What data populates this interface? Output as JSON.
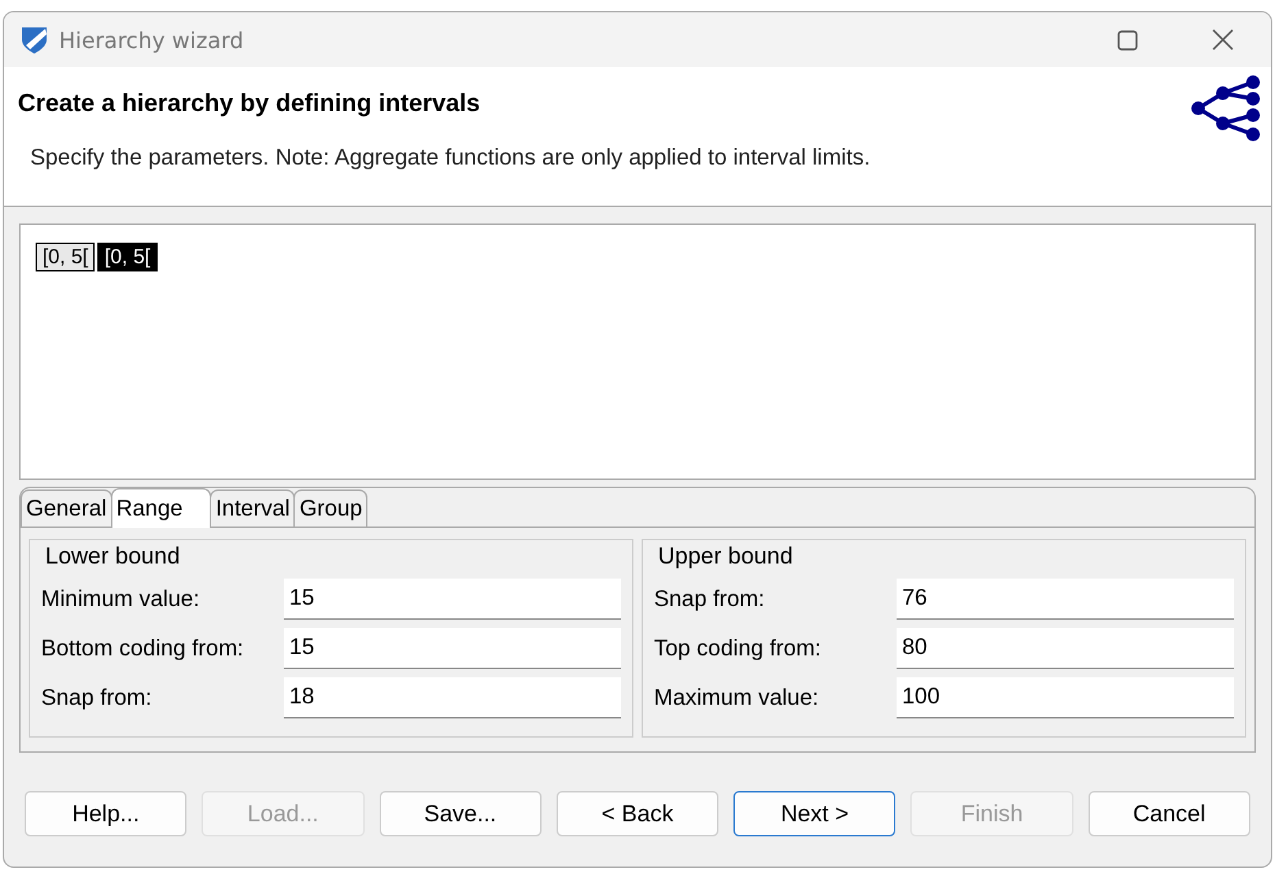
{
  "window": {
    "title": "Hierarchy wizard"
  },
  "header": {
    "title": "Create a hierarchy by defining intervals",
    "description": "Specify the parameters. Note: Aggregate functions are only applied to interval limits."
  },
  "intervals": [
    {
      "label": "[0, 5[",
      "selected": false
    },
    {
      "label": "[0, 5[",
      "selected": true
    }
  ],
  "tabs": [
    {
      "label": "General",
      "selected": false
    },
    {
      "label": "Range",
      "selected": true
    },
    {
      "label": "Interval",
      "selected": false
    },
    {
      "label": "Group",
      "selected": false
    }
  ],
  "groups": [
    {
      "title": "Lower bound",
      "fields": [
        {
          "label": "Minimum value:",
          "value": "15"
        },
        {
          "label": "Bottom coding from:",
          "value": "15"
        },
        {
          "label": "Snap from:",
          "value": "18"
        }
      ]
    },
    {
      "title": "Upper bound",
      "fields": [
        {
          "label": "Snap from:",
          "value": "76"
        },
        {
          "label": "Top coding from:",
          "value": "80"
        },
        {
          "label": "Maximum value:",
          "value": "100"
        }
      ]
    }
  ],
  "buttons": [
    {
      "label": "Help...",
      "disabled": false,
      "default": false
    },
    {
      "label": "Load...",
      "disabled": true,
      "default": false
    },
    {
      "label": "Save...",
      "disabled": false,
      "default": false
    },
    {
      "label": "< Back",
      "disabled": false,
      "default": false
    },
    {
      "label": "Next >",
      "disabled": false,
      "default": true
    },
    {
      "label": "Finish",
      "disabled": true,
      "default": false
    },
    {
      "label": "Cancel",
      "disabled": false,
      "default": false
    }
  ]
}
